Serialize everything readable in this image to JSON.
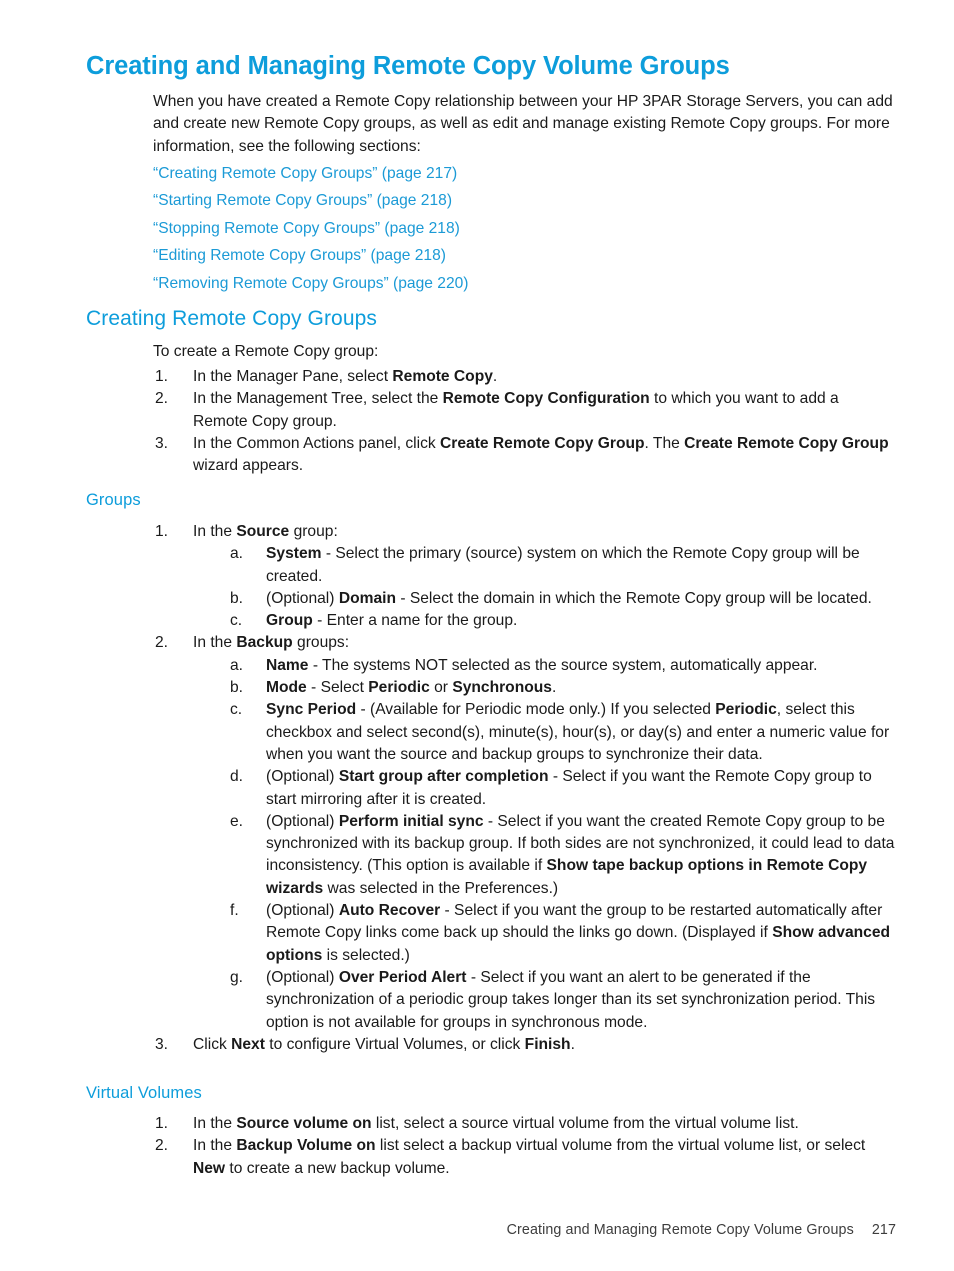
{
  "page": {
    "chapter_title": "Creating and Managing Remote Copy Volume Groups",
    "intro_paragraph": "When you have created a Remote Copy relationship between your HP 3PAR Storage Servers, you can add and create new Remote Copy groups, as well as edit and manage existing Remote Copy groups. For more information, see the following sections:",
    "cross_references": [
      "“Creating Remote Copy Groups” (page 217)",
      "“Starting Remote Copy Groups” (page 218)",
      "“Stopping Remote Copy Groups” (page 218)",
      "“Editing Remote Copy Groups” (page 218)",
      "“Removing Remote Copy Groups” (page 220)"
    ]
  },
  "creating_section": {
    "heading": "Creating Remote Copy Groups",
    "lead_in": "To create a Remote Copy group:",
    "steps": [
      {
        "marker": "1.",
        "parts": [
          {
            "text": "In the Manager Pane, select ",
            "bold": false
          },
          {
            "text": "Remote Copy",
            "bold": true
          },
          {
            "text": ".",
            "bold": false
          }
        ]
      },
      {
        "marker": "2.",
        "parts": [
          {
            "text": "In the Management Tree, select the ",
            "bold": false
          },
          {
            "text": "Remote Copy Configuration",
            "bold": true
          },
          {
            "text": " to which you want to add a Remote Copy group.",
            "bold": false
          }
        ]
      },
      {
        "marker": "3.",
        "parts": [
          {
            "text": "In the Common Actions panel, click ",
            "bold": false
          },
          {
            "text": "Create Remote Copy Group",
            "bold": true
          },
          {
            "text": ". The ",
            "bold": false
          },
          {
            "text": "Create Remote Copy Group",
            "bold": true
          },
          {
            "text": " wizard appears.",
            "bold": false
          }
        ]
      }
    ]
  },
  "groups_section": {
    "heading": "Groups",
    "steps": [
      {
        "marker": "1.",
        "parts": [
          {
            "text": "In the ",
            "bold": false
          },
          {
            "text": "Source",
            "bold": true
          },
          {
            "text": " group:",
            "bold": false
          }
        ],
        "substeps": [
          {
            "marker": "a.",
            "parts": [
              {
                "text": "System",
                "bold": true
              },
              {
                "text": " - Select the primary (source) system on which the Remote Copy group will be created.",
                "bold": false
              }
            ]
          },
          {
            "marker": "b.",
            "parts": [
              {
                "text": "(Optional) ",
                "bold": false
              },
              {
                "text": "Domain",
                "bold": true
              },
              {
                "text": " - Select the domain in which the Remote Copy group will be located.",
                "bold": false
              }
            ]
          },
          {
            "marker": "c.",
            "parts": [
              {
                "text": "Group",
                "bold": true
              },
              {
                "text": " - Enter a name for the group.",
                "bold": false
              }
            ]
          }
        ]
      },
      {
        "marker": "2.",
        "parts": [
          {
            "text": "In the ",
            "bold": false
          },
          {
            "text": "Backup",
            "bold": true
          },
          {
            "text": " groups:",
            "bold": false
          }
        ],
        "substeps": [
          {
            "marker": "a.",
            "parts": [
              {
                "text": "Name",
                "bold": true
              },
              {
                "text": " - The systems NOT selected as the source system, automatically appear.",
                "bold": false
              }
            ]
          },
          {
            "marker": "b.",
            "parts": [
              {
                "text": "Mode",
                "bold": true
              },
              {
                "text": " - Select ",
                "bold": false
              },
              {
                "text": "Periodic",
                "bold": true
              },
              {
                "text": " or ",
                "bold": false
              },
              {
                "text": "Synchronous",
                "bold": true
              },
              {
                "text": ".",
                "bold": false
              }
            ]
          },
          {
            "marker": "c.",
            "parts": [
              {
                "text": "Sync Period",
                "bold": true
              },
              {
                "text": " - (Available for Periodic mode only.) If you selected ",
                "bold": false
              },
              {
                "text": "Periodic",
                "bold": true
              },
              {
                "text": ", select this checkbox and select second(s), minute(s), hour(s), or day(s) and enter a numeric value for when you want the source and backup groups to synchronize their data.",
                "bold": false
              }
            ]
          },
          {
            "marker": "d.",
            "parts": [
              {
                "text": "(Optional) ",
                "bold": false
              },
              {
                "text": "Start group after completion",
                "bold": true
              },
              {
                "text": " - Select if you want the Remote Copy group to start mirroring after it is created.",
                "bold": false
              }
            ]
          },
          {
            "marker": "e.",
            "parts": [
              {
                "text": "(Optional) ",
                "bold": false
              },
              {
                "text": "Perform initial sync",
                "bold": true
              },
              {
                "text": " - Select if you want the created Remote Copy group to be synchronized with its backup group. If both sides are not synchronized, it could lead to data inconsistency. (This option is available if ",
                "bold": false
              },
              {
                "text": "Show tape backup options in Remote Copy wizards",
                "bold": true
              },
              {
                "text": " was selected in the Preferences.)",
                "bold": false
              }
            ]
          },
          {
            "marker": "f.",
            "parts": [
              {
                "text": "(Optional) ",
                "bold": false
              },
              {
                "text": "Auto Recover",
                "bold": true
              },
              {
                "text": " - Select if you want the group to be restarted automatically after Remote Copy links come back up should the links go down. (Displayed if ",
                "bold": false
              },
              {
                "text": "Show advanced options",
                "bold": true
              },
              {
                "text": " is selected.)",
                "bold": false
              }
            ]
          },
          {
            "marker": "g.",
            "parts": [
              {
                "text": "(Optional) ",
                "bold": false
              },
              {
                "text": "Over Period Alert",
                "bold": true
              },
              {
                "text": " - Select if you want an alert to be generated if the synchronization of a periodic group takes longer than its set synchronization period. This option is not available for groups in synchronous mode.",
                "bold": false
              }
            ]
          }
        ]
      },
      {
        "marker": "3.",
        "parts": [
          {
            "text": "Click ",
            "bold": false
          },
          {
            "text": "Next",
            "bold": true
          },
          {
            "text": " to configure Virtual Volumes, or click ",
            "bold": false
          },
          {
            "text": "Finish",
            "bold": true
          },
          {
            "text": ".",
            "bold": false
          }
        ],
        "substeps": []
      }
    ]
  },
  "virtual_volumes_section": {
    "heading": "Virtual Volumes",
    "steps": [
      {
        "marker": "1.",
        "parts": [
          {
            "text": "In the ",
            "bold": false
          },
          {
            "text": "Source volume on",
            "bold": true
          },
          {
            "text": " list, select a source virtual volume from the virtual volume list.",
            "bold": false
          }
        ]
      },
      {
        "marker": "2.",
        "parts": [
          {
            "text": "In the ",
            "bold": false
          },
          {
            "text": "Backup Volume on",
            "bold": true
          },
          {
            "text": " list select a backup virtual volume from the virtual volume list, or select ",
            "bold": false
          },
          {
            "text": "New",
            "bold": true
          },
          {
            "text": " to create a new backup volume.",
            "bold": false
          }
        ]
      }
    ]
  },
  "footer": {
    "running_title": "Creating and Managing Remote Copy Volume Groups",
    "page_number": "217"
  },
  "colors": {
    "heading": "#0d9ddb",
    "link": "#1b9ad6",
    "body_text": "#1a1a1a",
    "footer_text": "#3d3d3d",
    "background": "#ffffff"
  }
}
